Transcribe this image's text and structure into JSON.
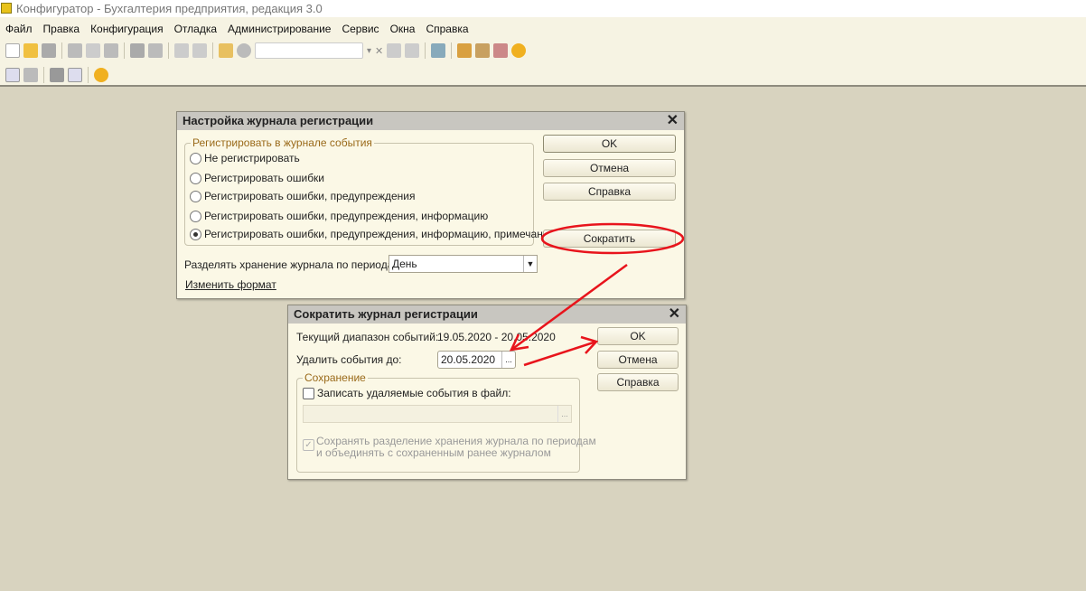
{
  "app": {
    "title": "Конфигуратор - Бухгалтерия предприятия, редакция 3.0"
  },
  "menu": [
    "Файл",
    "Правка",
    "Конфигурация",
    "Отладка",
    "Администрирование",
    "Сервис",
    "Окна",
    "Справка"
  ],
  "toolbar": {
    "search_value": ""
  },
  "dialog1": {
    "title": "Настройка журнала регистрации",
    "group_label": "Регистрировать в журнале события",
    "options": [
      "Не регистрировать",
      "Регистрировать ошибки",
      "Регистрировать ошибки, предупреждения",
      "Регистрировать ошибки, предупреждения, информацию",
      "Регистрировать ошибки, предупреждения, информацию, примечания"
    ],
    "selected_option": 4,
    "period_label": "Разделять хранение журнала по периодам",
    "period_value": "День",
    "change_format_link": "Изменить формат",
    "ok": "OK",
    "cancel": "Отмена",
    "help": "Справка",
    "shrink": "Сократить"
  },
  "dialog2": {
    "title": "Сократить журнал регистрации",
    "range_label": "Текущий диапазон событий:",
    "range_value": "19.05.2020 - 20.05.2020",
    "delete_label": "Удалить события до:",
    "delete_value": "20.05.2020",
    "ellipsis": "...",
    "group_label": "Сохранение",
    "write_file_label": "Записать удаляемые события в файл:",
    "write_file_checked": false,
    "file_path": "",
    "keep_split_label_1": "Сохранять разделение хранения журнала по периодам",
    "keep_split_label_2": "и объединять с сохраненным ранее журналом",
    "keep_split_checked": true,
    "ok": "OK",
    "cancel": "Отмена",
    "help": "Справка"
  },
  "annotation_color": "#e8141c"
}
